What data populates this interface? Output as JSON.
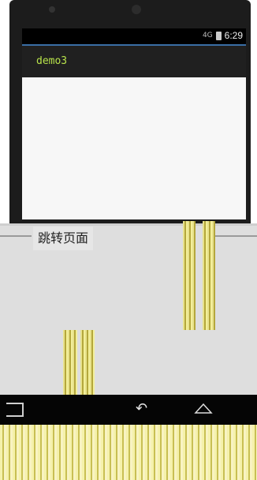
{
  "status_bar": {
    "signal_label": "4G",
    "time": "6:29"
  },
  "app": {
    "title": "demo3"
  },
  "content": {
    "jump_button_label": "跳转页面"
  },
  "nav": {
    "back_symbol": "↶",
    "home_symbol": "⌂"
  },
  "colors": {
    "accent_blue": "#3a6ea5",
    "title_green": "#b7e24a",
    "panel_gray": "#dedede"
  },
  "icons": [
    "signal-icon",
    "battery-icon",
    "back-icon",
    "home-icon",
    "recent-apps-icon"
  ]
}
